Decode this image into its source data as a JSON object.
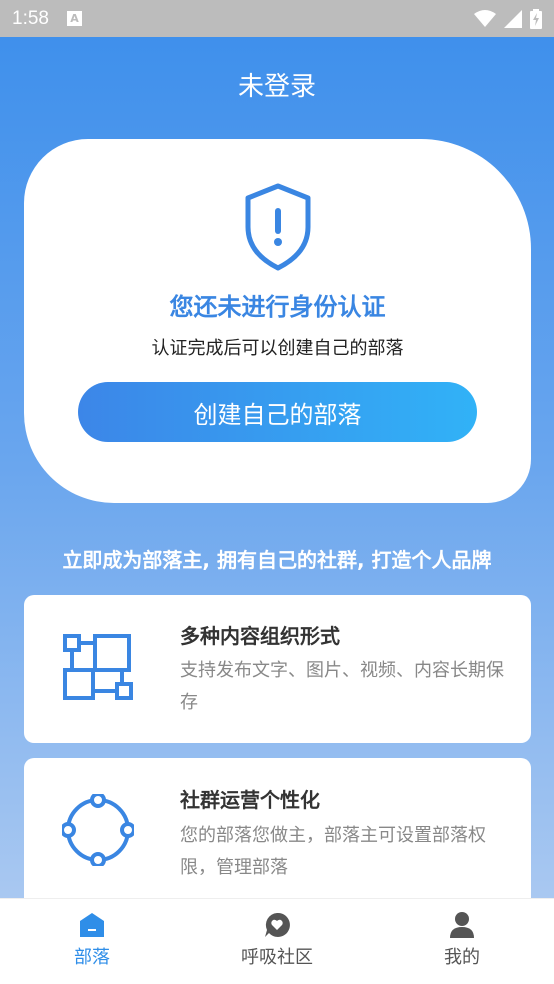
{
  "status_bar": {
    "time": "1:58",
    "badge": "A",
    "icons": [
      "wifi-icon",
      "signal-icon",
      "battery-charging-icon"
    ]
  },
  "header": {
    "title": "未登录"
  },
  "auth_card": {
    "icon": "shield-alert-icon",
    "title": "您还未进行身份认证",
    "subtitle": "认证完成后可以创建自己的部落",
    "button_label": "创建自己的部落"
  },
  "slogan": "立即成为部落主, 拥有自己的社群, 打造个人品牌",
  "features": [
    {
      "icon": "layout-blocks-icon",
      "title": "多种内容组织形式",
      "desc": "支持发布文字、图片、视频、内容长期保存"
    },
    {
      "icon": "circle-nodes-icon",
      "title": "社群运营个性化",
      "desc": "您的部落您做主，部落主可设置部落权限，管理部落"
    }
  ],
  "tabs": [
    {
      "label": "部落",
      "icon": "home-icon",
      "active": true
    },
    {
      "label": "呼吸社区",
      "icon": "chat-heart-icon",
      "active": false
    },
    {
      "label": "我的",
      "icon": "user-icon",
      "active": false
    }
  ],
  "colors": {
    "primary": "#3a86e2",
    "accent_gradient_start": "#3c86e8",
    "accent_gradient_end": "#31b2f7",
    "tab_active": "#2f8ee8"
  }
}
